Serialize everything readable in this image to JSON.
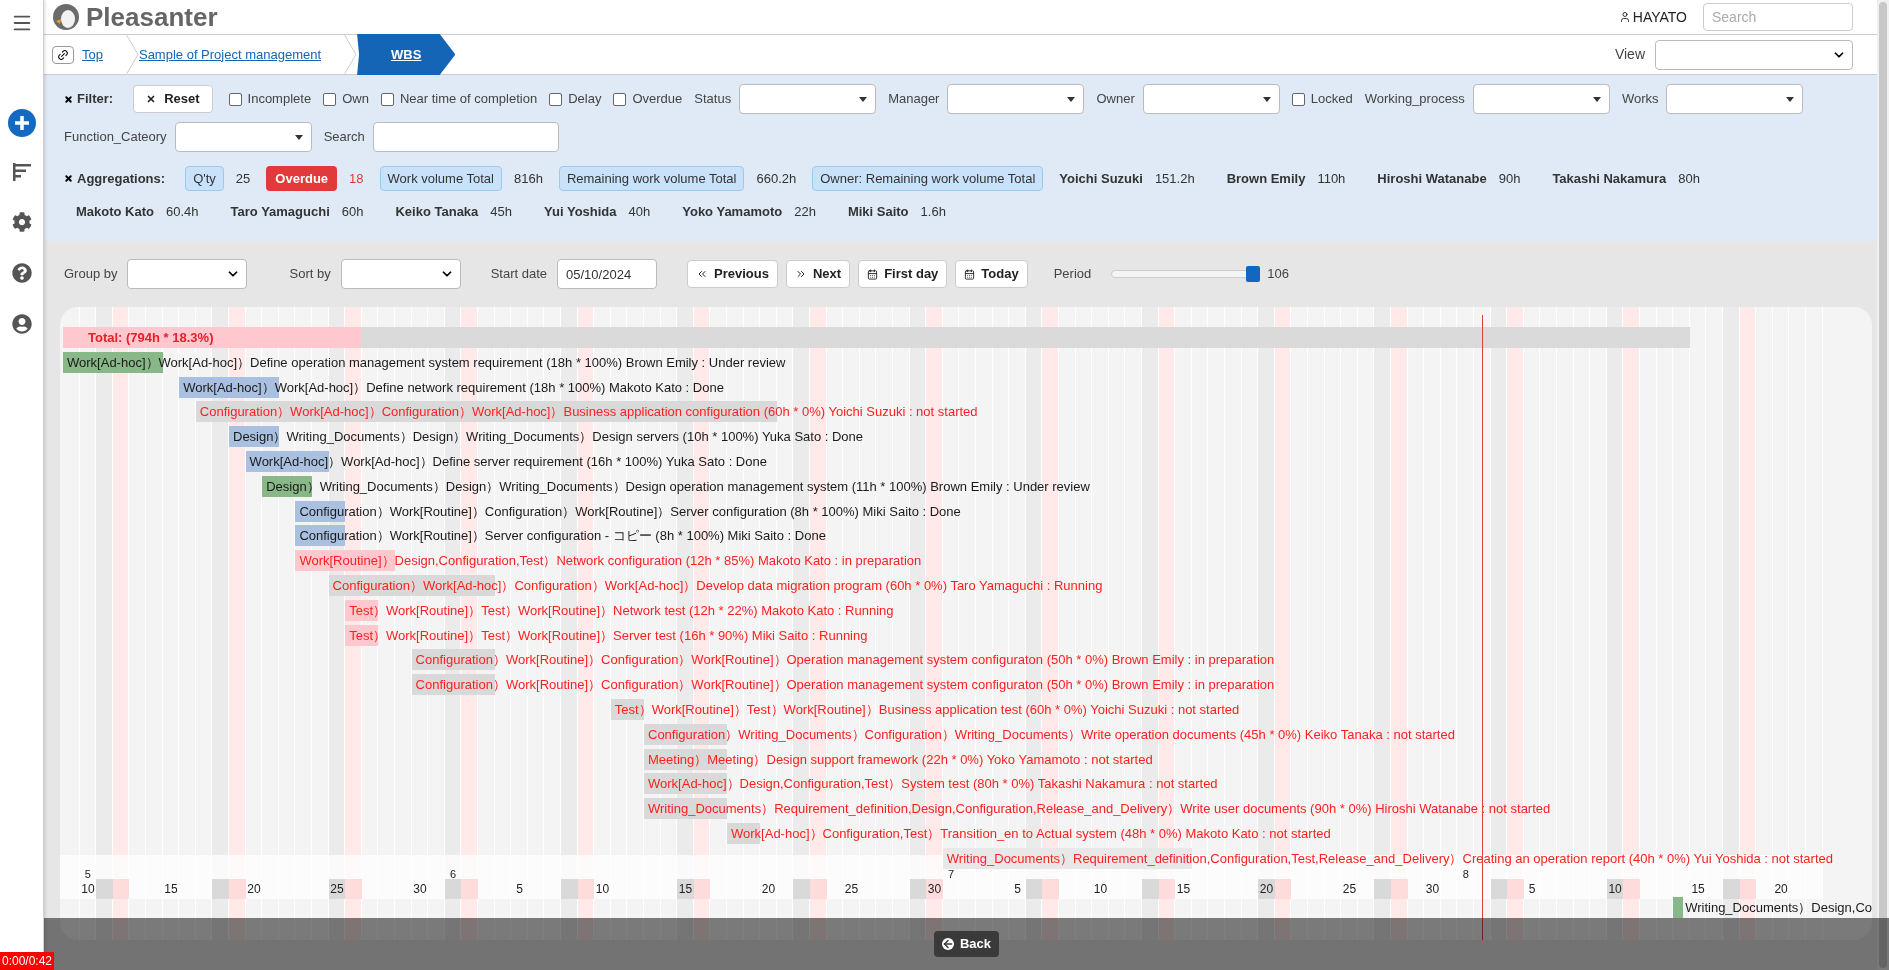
{
  "header": {
    "title": "Pleasanter",
    "user": "HAYATO",
    "search_placeholder": "Search"
  },
  "breadcrumb": [
    {
      "label": "Top",
      "selected": false
    },
    {
      "label": "Sample of Project management",
      "selected": false
    },
    {
      "label": "WBS",
      "selected": true
    }
  ],
  "view": {
    "label": "View"
  },
  "filter": {
    "title": "Filter:",
    "items": [
      {
        "kind": "button",
        "label": "Reset"
      },
      {
        "kind": "checkbox",
        "label": "Incomplete",
        "checked": false
      },
      {
        "kind": "checkbox",
        "label": "Own",
        "checked": false
      },
      {
        "kind": "checkbox",
        "label": "Near time of completion",
        "checked": false
      },
      {
        "kind": "checkbox",
        "label": "Delay",
        "checked": false
      },
      {
        "kind": "checkbox",
        "label": "Overdue",
        "checked": false
      },
      {
        "kind": "select",
        "label": "Status"
      },
      {
        "kind": "select",
        "label": "Manager"
      },
      {
        "kind": "select",
        "label": "Owner"
      },
      {
        "kind": "checkbox",
        "label": "Locked",
        "checked": false
      },
      {
        "kind": "select",
        "label": "Working_process"
      },
      {
        "kind": "select",
        "label": "Works"
      },
      {
        "kind": "select",
        "label": "Function_Cateory"
      },
      {
        "kind": "text",
        "label": "Search"
      }
    ]
  },
  "aggregations": {
    "title": "Aggregations:",
    "items": [
      {
        "kind": "chip",
        "label": "Q'ty",
        "value": "25"
      },
      {
        "kind": "alert",
        "label": "Overdue",
        "value": "18"
      },
      {
        "kind": "chip",
        "label": "Work volume Total",
        "value": "816h"
      },
      {
        "kind": "chip",
        "label": "Remaining work volume Total",
        "value": "660.2h"
      },
      {
        "kind": "chip",
        "label": "Owner: Remaining work volume Total"
      },
      {
        "kind": "person",
        "label": "Yoichi Suzuki",
        "value": "151.2h"
      },
      {
        "kind": "person",
        "label": "Brown Emily",
        "value": "110h"
      },
      {
        "kind": "person",
        "label": "Hiroshi Watanabe",
        "value": "90h"
      },
      {
        "kind": "person",
        "label": "Takashi Nakamura",
        "value": "80h"
      },
      {
        "kind": "person",
        "label": "Makoto Kato",
        "value": "60.4h"
      },
      {
        "kind": "person",
        "label": "Taro Yamaguchi",
        "value": "60h"
      },
      {
        "kind": "person",
        "label": "Keiko Tanaka",
        "value": "45h"
      },
      {
        "kind": "person",
        "label": "Yui Yoshida",
        "value": "40h"
      },
      {
        "kind": "person",
        "label": "Yoko Yamamoto",
        "value": "22h"
      },
      {
        "kind": "person",
        "label": "Miki Saito",
        "value": "1.6h"
      }
    ]
  },
  "controls": {
    "group_by": "Group by",
    "sort_by": "Sort by",
    "start_date": {
      "label": "Start date",
      "value": "05/10/2024"
    },
    "buttons": [
      {
        "kind": "previous",
        "label": "Previous"
      },
      {
        "kind": "next",
        "label": "Next"
      },
      {
        "kind": "calendar",
        "label": "First day"
      },
      {
        "kind": "calendar",
        "label": "Today"
      }
    ],
    "period": {
      "label": "Period",
      "level": 0.96,
      "value": "106"
    }
  },
  "gantt": {
    "total": {
      "label": "Total: (794h * 18.3%)",
      "level": 0.183
    },
    "rows": [
      {
        "color": "#88b888",
        "overdue": false,
        "text": "Work[Ad-hoc]）Work[Ad-hoc]）Define operation management system requirement (18h * 100%) Brown Emily : Under review"
      },
      {
        "color": "#a9c0e0",
        "overdue": false,
        "text": "Work[Ad-hoc]）Work[Ad-hoc]）Define network requirement (18h * 100%) Makoto Kato : Done"
      },
      {
        "color": "#d9d9d9",
        "overdue": true,
        "text": "Configuration）Work[Ad-hoc]）Configuration）Work[Ad-hoc]）Business application configuration (60h * 0%) Yoichi Suzuki : not started"
      },
      {
        "color": "#a9c0e0",
        "overdue": false,
        "text": "Design）Writing_Documents）Design）Writing_Documents）Design servers (10h * 100%) Yuka Sato : Done"
      },
      {
        "color": "#a9c0e0",
        "overdue": false,
        "text": "Work[Ad-hoc]）Work[Ad-hoc]）Define server requirement (16h * 100%) Yuka Sato : Done"
      },
      {
        "color": "#88b888",
        "overdue": false,
        "text": "Design）Writing_Documents）Design）Writing_Documents）Design operation management system (11h * 100%) Brown Emily : Under review"
      },
      {
        "color": "#a9c0e0",
        "overdue": false,
        "text": "Configuration）Work[Routine]）Configuration）Work[Routine]）Server configuration (8h * 100%) Miki Saito : Done"
      },
      {
        "color": "#a9c0e0",
        "overdue": false,
        "text": "Configuration）Work[Routine]）Server configuration - コピー (8h * 100%) Miki Saito : Done"
      },
      {
        "color": "#ffc8ce",
        "overdue": true,
        "text": "Work[Routine]）Design,Configuration,Test）Network configuration (12h * 85%) Makoto Kato : in preparation"
      },
      {
        "color": "#d9d9d9",
        "overdue": true,
        "text": "Configuration）Work[Ad-hoc]）Configuration）Work[Ad-hoc]）Develop data migration program (60h * 0%) Taro Yamaguchi : Running"
      },
      {
        "color": "#ffc8ce",
        "overdue": true,
        "text": "Test）Work[Routine]）Test）Work[Routine]）Network test (12h * 22%) Makoto Kato : Running"
      },
      {
        "color": "#ffc8ce",
        "overdue": true,
        "text": "Test）Work[Routine]）Test）Work[Routine]）Server test (16h * 90%) Miki Saito : Running"
      },
      {
        "color": "#d9d9d9",
        "overdue": true,
        "text": "Configuration）Work[Routine]）Configuration）Work[Routine]）Operation management system configuraton (50h * 0%) Brown Emily : in preparation"
      },
      {
        "color": "#d9d9d9",
        "overdue": true,
        "text": "Configuration）Work[Routine]）Configuration）Work[Routine]）Operation management system configuraton (50h * 0%) Brown Emily : in preparation"
      },
      {
        "color": "#d9d9d9",
        "overdue": true,
        "text": "Test）Work[Routine]）Test）Work[Routine]）Business application test (60h * 0%) Yoichi Suzuki : not started"
      },
      {
        "color": "#d9d9d9",
        "overdue": true,
        "text": "Configuration）Writing_Documents）Configuration）Writing_Documents）Write operation documents (45h * 0%) Keiko Tanaka : not started"
      },
      {
        "color": "#d9d9d9",
        "overdue": true,
        "text": "Meeting）Meeting）Design support framework (22h * 0%) Yoko Yamamoto : not started"
      },
      {
        "color": "#d9d9d9",
        "overdue": true,
        "text": "Work[Ad-hoc]）Design,Configuration,Test）System test (80h * 0%) Takashi Nakamura : not started"
      },
      {
        "color": "#d9d9d9",
        "overdue": true,
        "text": "Writing_Documents）Requirement_definition,Design,Configuration,Release_and_Delivery）Write user documents (90h * 0%) Hiroshi Watanabe : not started"
      },
      {
        "color": "#d9d9d9",
        "overdue": true,
        "text": "Work[Ad-hoc]）Configuration,Test）Transition_en to Actual system (48h * 0%) Makoto Kato : not started"
      },
      {
        "color": "#e8e8e8",
        "overdue": true,
        "text": "Writing_Documents）Requirement_definition,Configuration,Test,Release_and_Delivery）Creating an operation report (40h * 0%) Yui Yoshida : not started"
      }
    ],
    "rows_below_axis": [
      {
        "color": "#88b888",
        "overdue": false,
        "text": "Writing_Documents）Design,Co"
      }
    ],
    "axis": {
      "months": [
        "5",
        "6",
        "7",
        "8"
      ],
      "days": [
        "10",
        "15",
        "20",
        "25",
        "30",
        "5",
        "10",
        "15",
        "20",
        "25",
        "30",
        "5",
        "10",
        "15",
        "20",
        "25",
        "30",
        "5",
        "10",
        "15",
        "20"
      ]
    }
  },
  "footer": {
    "back": "Back",
    "timer": "0:00/0:42"
  }
}
